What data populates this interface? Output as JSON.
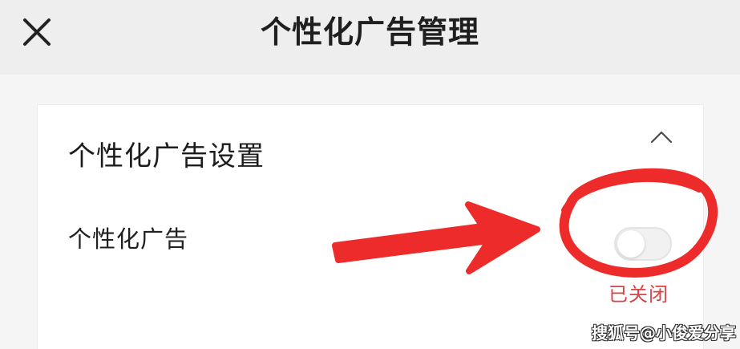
{
  "header": {
    "title": "个性化广告管理",
    "close_icon": "close-icon"
  },
  "settings": {
    "section_title": "个性化广告设置",
    "collapse_icon": "chevron-up-icon",
    "row": {
      "label": "个性化广告",
      "toggle_on": false,
      "status": "已关闭",
      "status_color": "#d84343"
    }
  },
  "annotation": {
    "arrow_color": "#ee2b2b",
    "circle_color": "#ee2b2b"
  },
  "watermark": {
    "text": "搜狐号@小俊爱分享"
  }
}
